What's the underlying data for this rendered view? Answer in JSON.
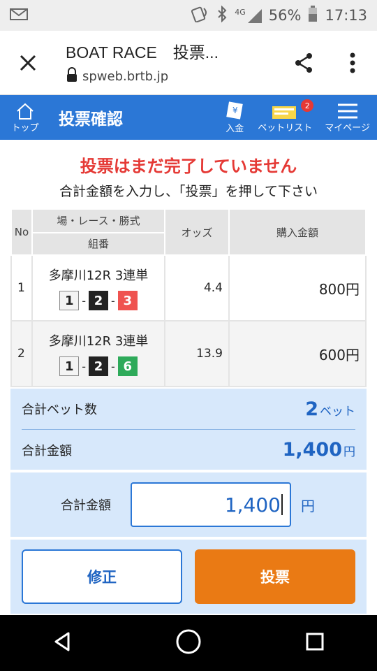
{
  "status_bar": {
    "network": "4G",
    "battery": "56%",
    "time": "17:13"
  },
  "browser": {
    "title": "BOAT RACE　投票...",
    "url": "spweb.brtb.jp"
  },
  "app_header": {
    "home_label": "トップ",
    "page_title": "投票確認",
    "deposit_label": "入金",
    "betlist_label": "ベットリスト",
    "betlist_count": "2",
    "mypage_label": "マイページ"
  },
  "alert": {
    "title": "投票はまだ完了していません",
    "subtitle": "合計金額を入力し、「投票」を押して下さい"
  },
  "table": {
    "headers": {
      "no": "No",
      "race_top": "場・レース・勝式",
      "race_bottom": "組番",
      "odds": "オッズ",
      "amount": "購入金額"
    },
    "rows": [
      {
        "no": "1",
        "race": "多摩川12R 3連単",
        "n1": "1",
        "n2": "2",
        "n3": "3",
        "sep": "-",
        "odds": "4.4",
        "amount": "800円"
      },
      {
        "no": "2",
        "race": "多摩川12R 3連単",
        "n1": "1",
        "n2": "2",
        "n3": "6",
        "sep": "-",
        "odds": "13.9",
        "amount": "600円"
      }
    ]
  },
  "summary": {
    "bet_count_label": "合計ベット数",
    "bet_count_value": "2",
    "bet_count_unit": "ベット",
    "total_label": "合計金額",
    "total_value": "1,400",
    "total_unit": "円"
  },
  "input": {
    "label": "合計金額",
    "value": "1,400",
    "unit": "円"
  },
  "buttons": {
    "fix": "修正",
    "vote": "投票"
  }
}
